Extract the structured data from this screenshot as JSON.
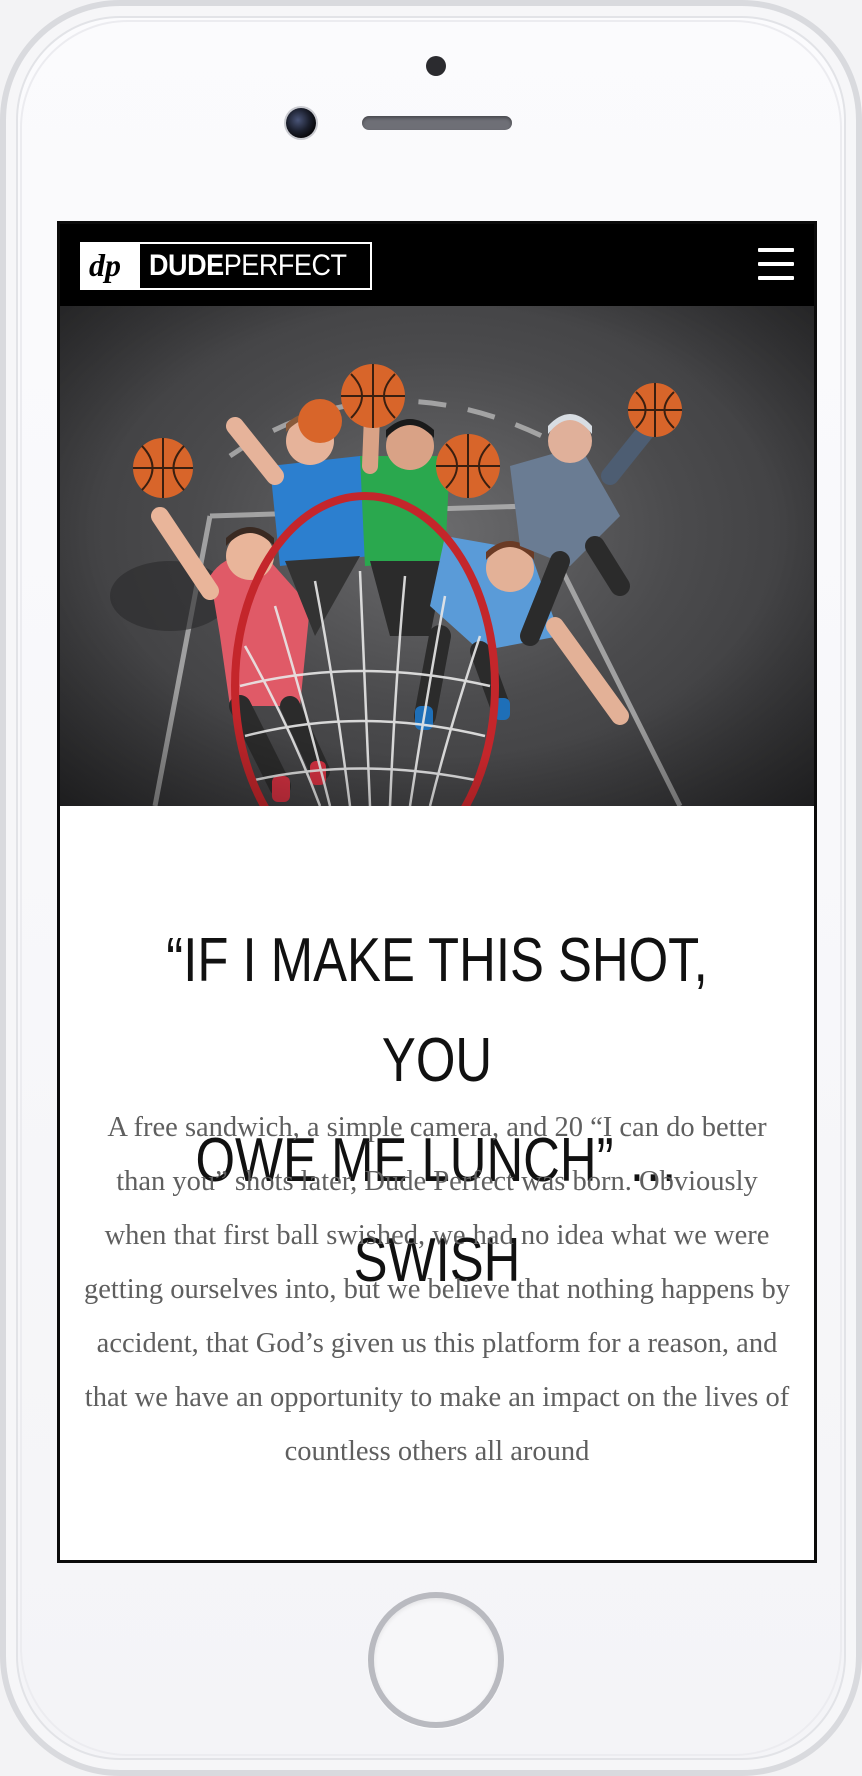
{
  "site": {
    "logo_bold": "DUDE",
    "logo_light": "PERFECT",
    "logo_mark": "dp"
  },
  "hero": {
    "image_alt": "Five Dude Perfect members jumping toward a basketball hoop, viewed from above",
    "icon": "basketball-hero-photo"
  },
  "main": {
    "headline_line1": "“IF I MAKE THIS SHOT, YOU",
    "headline_line2": "OWE ME LUNCH” …SWISH",
    "body": "A free sandwich, a simple camera, and 20 “I can do better than you” shots later, Dude Perfect was born. Obviously when that first ball swished, we had no idea what we were getting ourselves into, but we believe that nothing happens by accident, that God’s given us this platform for a reason, and that we have an opportunity to make an impact on the lives of countless others all around"
  },
  "colors": {
    "navbar": "#000000",
    "headline": "#111111",
    "body_text": "#5f5f5f",
    "rim": "#c4262b"
  }
}
